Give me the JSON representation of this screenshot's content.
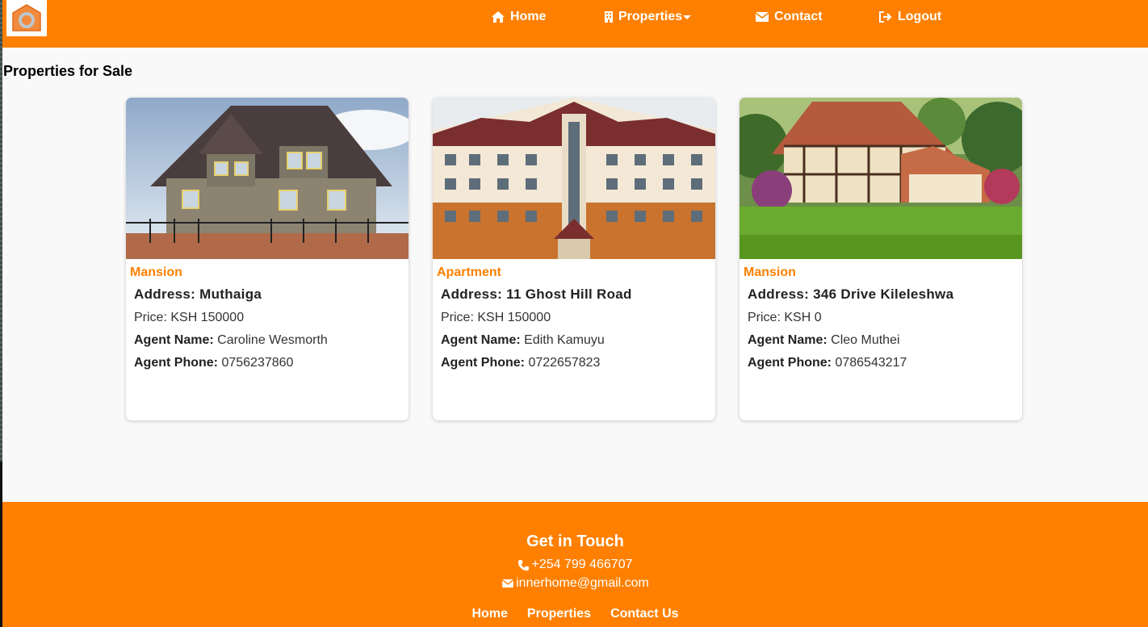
{
  "colors": {
    "brand": "#ff8000",
    "background": "#f9f9f9",
    "text": "#222222"
  },
  "nav": {
    "logo_icon": "house-logo-icon",
    "items": [
      {
        "label": "Home",
        "icon": "home-icon"
      },
      {
        "label": "Properties",
        "icon": "building-icon",
        "dropdown_icon": "caret-down-icon"
      },
      {
        "label": "Contact",
        "icon": "envelope-icon"
      },
      {
        "label": "Logout",
        "icon": "logout-icon"
      }
    ]
  },
  "page": {
    "title": "Properties for Sale"
  },
  "properties": [
    {
      "type": "Mansion",
      "address_label": "Address:",
      "address": "Muthaiga",
      "price_label": "Price:",
      "price": "KSH 150000",
      "agent_name_label": "Agent Name:",
      "agent_name": "Caroline Wesmorth",
      "agent_phone_label": "Agent Phone:",
      "agent_phone": "0756237860"
    },
    {
      "type": "Apartment",
      "address_label": "Address:",
      "address": "11 Ghost Hill Road",
      "price_label": "Price:",
      "price": "KSH 150000",
      "agent_name_label": "Agent Name:",
      "agent_name": "Edith Kamuyu",
      "agent_phone_label": "Agent Phone:",
      "agent_phone": "0722657823"
    },
    {
      "type": "Mansion",
      "address_label": "Address:",
      "address": "346 Drive Kileleshwa",
      "price_label": "Price:",
      "price": "KSH 0",
      "agent_name_label": "Agent Name:",
      "agent_name": "Cleo Muthei",
      "agent_phone_label": "Agent Phone:",
      "agent_phone": "0786543217"
    }
  ],
  "footer": {
    "title": "Get in Touch",
    "phone": "+254 799 466707",
    "phone_icon": "phone-icon",
    "email": "innerhome@gmail.com",
    "email_icon": "envelope-icon",
    "links": [
      "Home",
      "Properties",
      "Contact Us"
    ]
  }
}
